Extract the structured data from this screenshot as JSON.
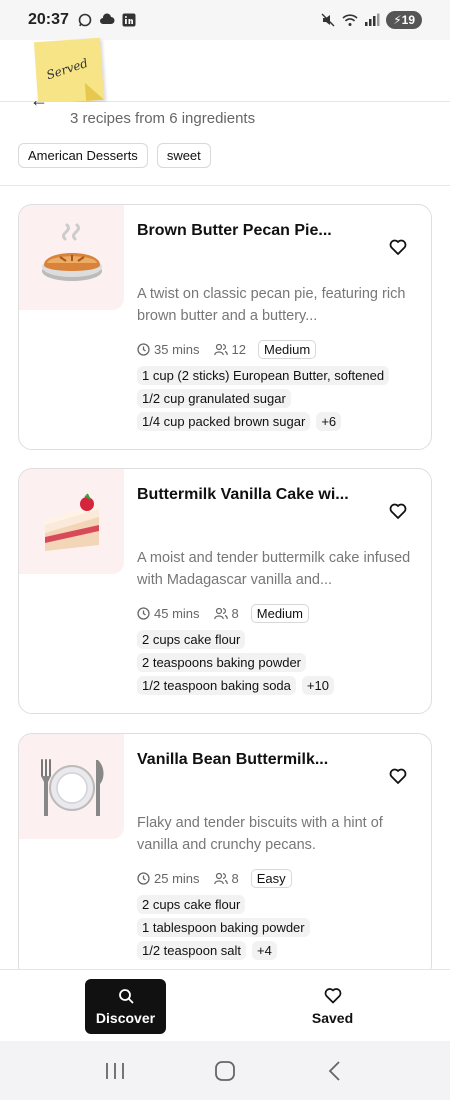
{
  "status_bar": {
    "time": "20:37",
    "battery": "19",
    "left_icons": [
      "whatsapp-icon",
      "cloud-icon",
      "linkedin-icon"
    ],
    "right_icons": [
      "mute-icon",
      "wifi-icon",
      "signal-icon"
    ]
  },
  "header": {
    "logo_text": "Served",
    "subtitle": "3 recipes from 6 ingredients",
    "tags": [
      "American Desserts",
      "sweet"
    ]
  },
  "recipes": [
    {
      "title": "Brown Butter Pecan Pie...",
      "description": "A twist on classic pecan pie, featuring rich brown butter and a buttery...",
      "time": "35 mins",
      "servings": "12",
      "difficulty": "Medium",
      "ingredients": [
        "1 cup (2 sticks) European Butter, softened",
        "1/2 cup granulated sugar",
        "1/4 cup packed brown sugar"
      ],
      "more": "+6",
      "image": "pie-icon"
    },
    {
      "title": "Buttermilk Vanilla Cake wi...",
      "description": "A moist and tender buttermilk cake infused with Madagascar vanilla and...",
      "time": "45 mins",
      "servings": "8",
      "difficulty": "Medium",
      "ingredients": [
        "2 cups cake flour",
        "2 teaspoons baking powder",
        "1/2 teaspoon baking soda"
      ],
      "more": "+10",
      "image": "cake-slice-icon"
    },
    {
      "title": "Vanilla Bean Buttermilk...",
      "description": "Flaky and tender biscuits with a hint of vanilla and crunchy pecans.",
      "time": "25 mins",
      "servings": "8",
      "difficulty": "Easy",
      "ingredients": [
        "2 cups cake flour",
        "1 tablespoon baking powder",
        "1/2 teaspoon salt"
      ],
      "more": "+4",
      "image": "plate-cutlery-icon"
    }
  ],
  "bottom_nav": {
    "discover_label": "Discover",
    "saved_label": "Saved"
  },
  "colors": {
    "accent": "#111111",
    "thumb_bg": "#fdf0f0",
    "chip_bg": "#f2f2f2"
  }
}
